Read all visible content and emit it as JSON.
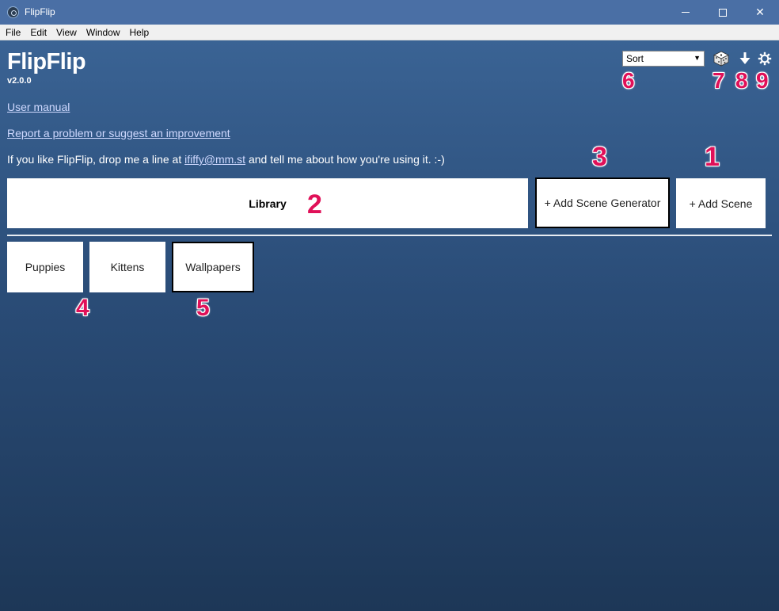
{
  "window": {
    "title": "FlipFlip",
    "minimize_label": "",
    "maximize_label": "",
    "close_label": "✕"
  },
  "menu": [
    "File",
    "Edit",
    "View",
    "Window",
    "Help"
  ],
  "app": {
    "title": "FlipFlip",
    "version": "v2.0.0"
  },
  "links": {
    "manual": "User manual",
    "report": "Report a problem or suggest an improvement"
  },
  "contact": {
    "prefix": "If you like FlipFlip, drop me a line at ",
    "email": "ififfy@mm.st",
    "suffix": " and tell me about how you're using it. :-)"
  },
  "toolbar": {
    "sort": {
      "value": "Sort",
      "arrow": "▼"
    },
    "icons": [
      "dice-icon",
      "download-icon",
      "settings-icon"
    ]
  },
  "library": {
    "label": "Library"
  },
  "buttons": {
    "add_scene_generator": "+ Add Scene Generator",
    "add_scene": "+ Add Scene"
  },
  "scenes": [
    {
      "label": "Puppies"
    },
    {
      "label": "Kittens"
    },
    {
      "label": "Wallpapers"
    }
  ],
  "callouts": {
    "add_scene": "1",
    "library": "2",
    "add_generator": "3",
    "first_scene": "4",
    "third_scene": "5",
    "sort": "6",
    "dice": "7",
    "download": "8",
    "settings": "9"
  },
  "colors": {
    "titlebar": "#4a6fa5",
    "background_top": "#3a6394",
    "background_bottom": "#1d3757",
    "callout": "#e01058",
    "link": "#cfd9ff"
  }
}
